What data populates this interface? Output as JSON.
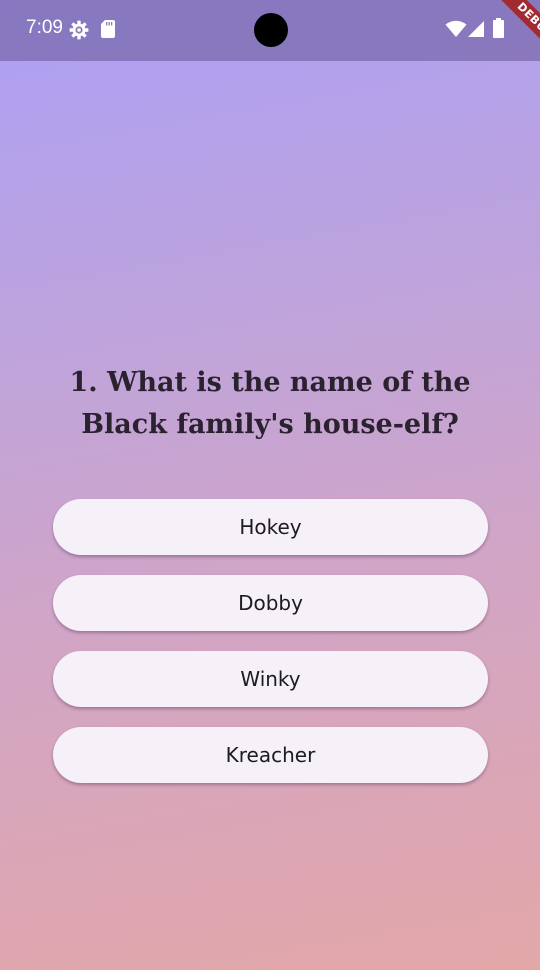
{
  "status_bar": {
    "time": "7:09",
    "icons": [
      "gear-icon",
      "sd-card-icon",
      "wifi-icon",
      "signal-icon",
      "battery-icon"
    ]
  },
  "debug_banner": {
    "label": "DEBUG",
    "color": "#a42222"
  },
  "quiz": {
    "question": "1. What is the name of the Black family's house-elf?",
    "answers": [
      "Hokey",
      "Dobby",
      "Winky",
      "Kreacher"
    ]
  },
  "colors": {
    "gradient_top": "#ada0f6",
    "gradient_bottom": "#e3a7a8",
    "button_background": "#f6f0f8",
    "question_text": "#2b2230"
  }
}
